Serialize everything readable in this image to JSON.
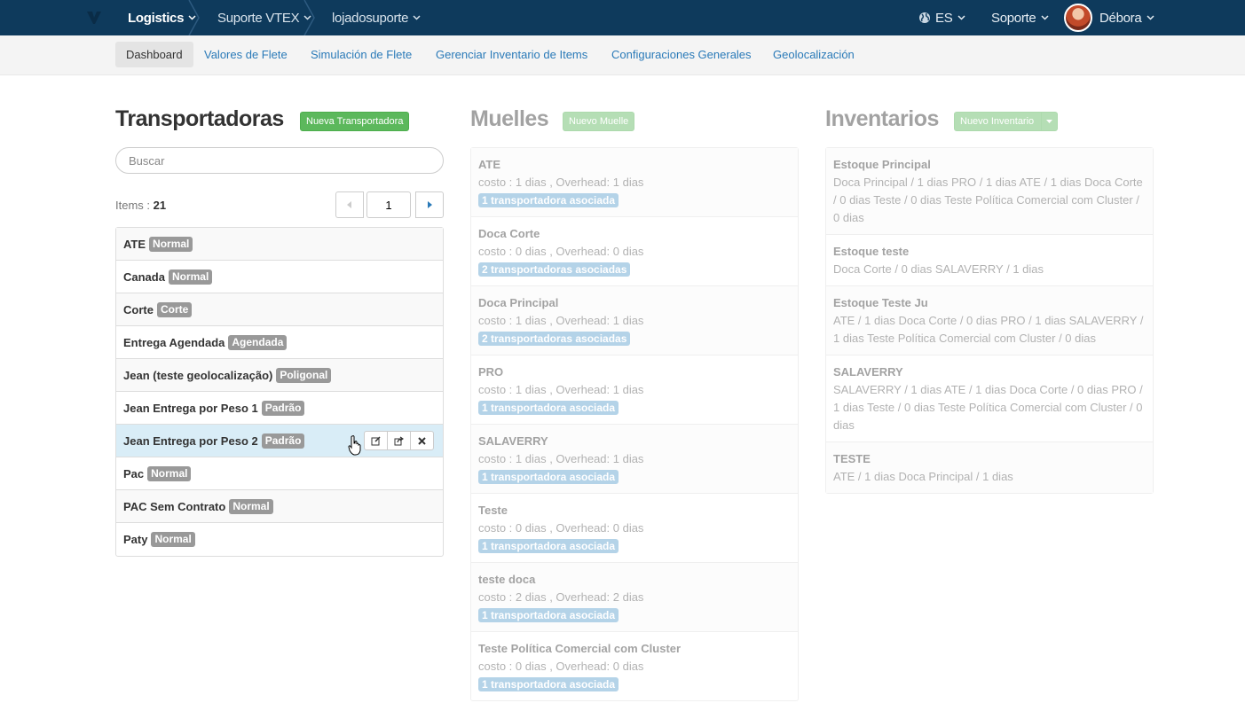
{
  "topbar": {
    "crumbs": [
      "Logistics",
      "Suporte VTEX",
      "lojadosuporte"
    ],
    "language": "ES",
    "support": "Soporte",
    "user": "Débora"
  },
  "subnav": {
    "tabs": [
      "Dashboard",
      "Valores de Flete",
      "Simulación de Flete",
      "Gerenciar Inventario de Items",
      "Configuraciones Generales",
      "Geolocalización"
    ]
  },
  "carriers": {
    "title": "Transportadoras",
    "new_button": "Nueva Transportadora",
    "search_placeholder": "Buscar",
    "items_label": "Items :",
    "items_count": "21",
    "page": "1",
    "rows": [
      {
        "name": "ATE",
        "badge": "Normal"
      },
      {
        "name": "Canada",
        "badge": "Normal"
      },
      {
        "name": "Corte",
        "badge": "Corte"
      },
      {
        "name": "Entrega Agendada",
        "badge": "Agendada"
      },
      {
        "name": "Jean (teste geolocalização)",
        "badge": "Poligonal"
      },
      {
        "name": "Jean Entrega por Peso 1",
        "badge": "Padrão"
      },
      {
        "name": "Jean Entrega por Peso 2",
        "badge": "Padrão"
      },
      {
        "name": "Pac",
        "badge": "Normal"
      },
      {
        "name": "PAC Sem Contrato",
        "badge": "Normal"
      },
      {
        "name": "Paty",
        "badge": "Normal"
      }
    ]
  },
  "docks": {
    "title": "Muelles",
    "new_button": "Nuevo Muelle",
    "rows": [
      {
        "name": "ATE",
        "detail": "costo : 1 dias , Overhead: 1 dias",
        "badge": "1 transportadora asociada"
      },
      {
        "name": "Doca Corte",
        "detail": "costo : 0 dias , Overhead: 0 dias",
        "badge": "2 transportadoras asociadas"
      },
      {
        "name": "Doca Principal",
        "detail": "costo : 1 dias , Overhead: 1 dias",
        "badge": "2 transportadoras asociadas"
      },
      {
        "name": "PRO",
        "detail": "costo : 1 dias , Overhead: 1 dias",
        "badge": "1 transportadora asociada"
      },
      {
        "name": "SALAVERRY",
        "detail": "costo : 1 dias , Overhead: 1 dias",
        "badge": "1 transportadora asociada"
      },
      {
        "name": "Teste",
        "detail": "costo : 0 dias , Overhead: 0 dias",
        "badge": "1 transportadora asociada"
      },
      {
        "name": "teste doca",
        "detail": "costo : 2 dias , Overhead: 2 dias",
        "badge": "1 transportadora asociada"
      },
      {
        "name": "Teste Política Comercial com Cluster",
        "detail": "costo : 0 dias , Overhead: 0 dias",
        "badge": "1 transportadora asociada"
      }
    ]
  },
  "inventories": {
    "title": "Inventarios",
    "new_button": "Nuevo Inventario",
    "rows": [
      {
        "name": "Estoque Principal",
        "detail": "Doca Principal / 1 dias PRO / 1 dias ATE / 1 dias Doca Corte / 0 dias Teste / 0 dias Teste Política Comercial com Cluster / 0 dias"
      },
      {
        "name": "Estoque teste",
        "detail": "Doca Corte / 0 dias SALAVERRY / 1 dias"
      },
      {
        "name": "Estoque Teste Ju",
        "detail": "ATE / 1 dias Doca Corte / 0 dias PRO / 1 dias SALAVERRY / 1 dias Teste Política Comercial com Cluster / 0 dias"
      },
      {
        "name": "SALAVERRY",
        "detail": "SALAVERRY / 1 dias ATE / 1 dias Doca Corte / 0 dias PRO / 1 dias Teste / 0 dias Teste Política Comercial com Cluster / 0 dias"
      },
      {
        "name": "TESTE",
        "detail": "ATE / 1 dias Doca Principal / 1 dias"
      }
    ]
  }
}
